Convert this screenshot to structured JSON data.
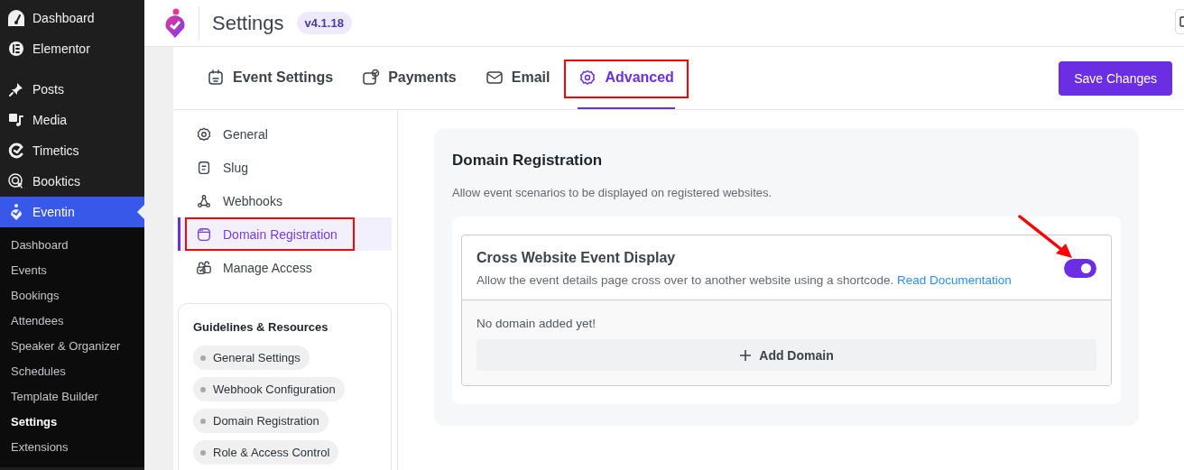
{
  "admin_menu": {
    "groups": [
      [
        {
          "label": "Dashboard",
          "selected": false
        },
        {
          "label": "Elementor",
          "selected": false
        }
      ],
      [
        {
          "label": "Posts",
          "selected": false
        },
        {
          "label": "Media",
          "selected": false
        },
        {
          "label": "Timetics",
          "selected": false
        },
        {
          "label": "Booktics",
          "selected": false
        },
        {
          "label": "Eventin",
          "selected": true
        }
      ]
    ],
    "submenu": [
      {
        "label": "Dashboard",
        "selected": false
      },
      {
        "label": "Events",
        "selected": false
      },
      {
        "label": "Bookings",
        "selected": false
      },
      {
        "label": "Attendees",
        "selected": false
      },
      {
        "label": "Speaker & Organizer",
        "selected": false
      },
      {
        "label": "Schedules",
        "selected": false
      },
      {
        "label": "Template Builder",
        "selected": false
      },
      {
        "label": "Settings",
        "selected": true
      },
      {
        "label": "Extensions",
        "selected": false
      }
    ]
  },
  "header": {
    "title": "Settings",
    "version": "v4.1.18"
  },
  "tabs": [
    {
      "label": "Event Settings",
      "selected": false,
      "annotated": false
    },
    {
      "label": "Payments",
      "selected": false,
      "annotated": false
    },
    {
      "label": "Email",
      "selected": false,
      "annotated": false
    },
    {
      "label": "Advanced",
      "selected": true,
      "annotated": true
    }
  ],
  "save_button": "Save Changes",
  "settings_nav": [
    {
      "label": "General",
      "selected": false,
      "annotated": false
    },
    {
      "label": "Slug",
      "selected": false,
      "annotated": false
    },
    {
      "label": "Webhooks",
      "selected": false,
      "annotated": false
    },
    {
      "label": "Domain Registration",
      "selected": true,
      "annotated": true
    },
    {
      "label": "Manage Access",
      "selected": false,
      "annotated": false
    }
  ],
  "guidelines": {
    "title": "Guidelines & Resources",
    "items": [
      "General Settings",
      "Webhook Configuration",
      "Domain Registration",
      "Role & Access Control"
    ]
  },
  "section": {
    "title": "Domain Registration",
    "description": "Allow event scenarios to be displayed on registered websites.",
    "setting": {
      "title": "Cross Website Event Display",
      "description": "Allow the event details page cross over to another website using a shortcode.",
      "link": "Read Documentation",
      "on": true,
      "annotated": true
    },
    "empty_text": "No domain added yet!",
    "add_button": "Add Domain"
  }
}
